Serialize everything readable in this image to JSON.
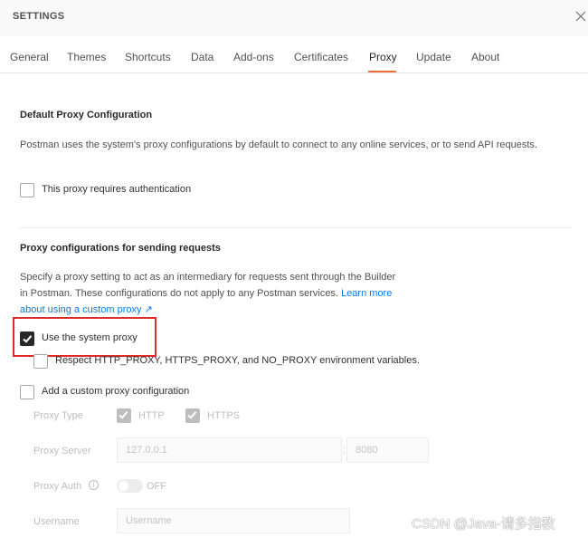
{
  "window": {
    "title": "SETTINGS",
    "close_icon": "close-icon"
  },
  "tabs": [
    {
      "label": "General"
    },
    {
      "label": "Themes"
    },
    {
      "label": "Shortcuts"
    },
    {
      "label": "Data"
    },
    {
      "label": "Add-ons"
    },
    {
      "label": "Certificates"
    },
    {
      "label": "Proxy",
      "active": true
    },
    {
      "label": "Update"
    },
    {
      "label": "About"
    }
  ],
  "colors": {
    "active_tab_underline": "#f26b3a",
    "link": "#097bed",
    "highlight_border": "#e02b2b"
  },
  "default_proxy": {
    "title": "Default Proxy Configuration",
    "description": "Postman uses the system's proxy configurations by default to connect to any online services, or to send API requests.",
    "auth_checkbox": {
      "label": "This proxy requires authentication",
      "checked": false
    }
  },
  "request_proxy": {
    "title": "Proxy configurations for sending requests",
    "description": "Specify a proxy setting to act as an intermediary for requests sent through the Builder in Postman. These configurations do not apply to any Postman services.",
    "learn_more": "Learn more about using a custom proxy ↗",
    "system_proxy": {
      "label": "Use the system proxy",
      "checked": true
    },
    "respect_env": {
      "label": "Respect HTTP_PROXY, HTTPS_PROXY, and NO_PROXY environment variables.",
      "checked": false
    },
    "custom_proxy": {
      "label": "Add a custom proxy configuration",
      "checked": false
    }
  },
  "custom_form": {
    "proxy_type_label": "Proxy Type",
    "http_label": "HTTP",
    "http_checked": true,
    "https_label": "HTTPS",
    "https_checked": true,
    "proxy_server_label": "Proxy Server",
    "server_placeholder": "127.0.0.1",
    "separator": ":",
    "port_placeholder": "8080",
    "proxy_auth_label": "Proxy Auth",
    "info_icon": "info-icon",
    "auth_toggle_state": "OFF",
    "username_label": "Username",
    "username_placeholder": "Username"
  },
  "watermark": "CSDN @Java-请多指教"
}
